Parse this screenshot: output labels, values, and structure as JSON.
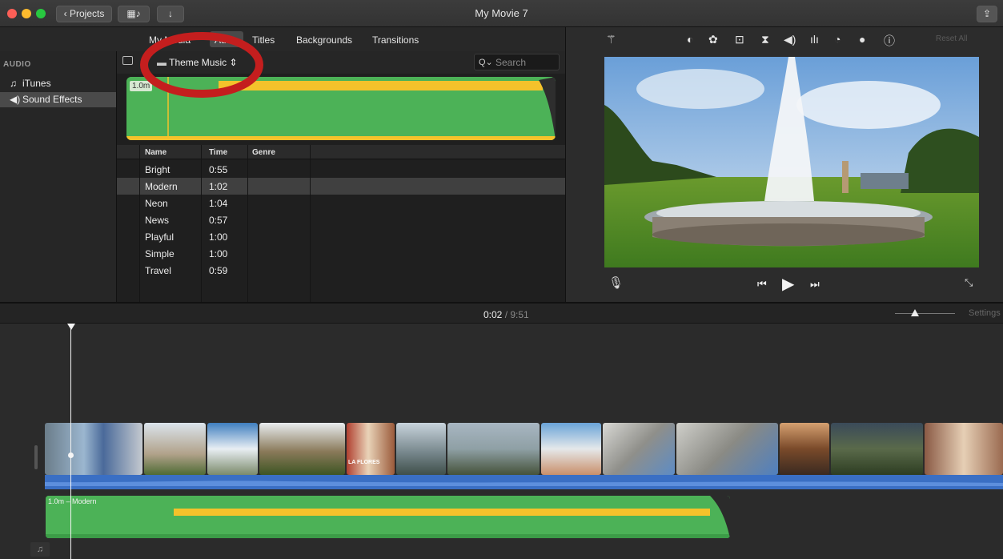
{
  "window": {
    "title": "My Movie 7"
  },
  "toolbar": {
    "projects_label": "Projects",
    "share_icon": "share-icon"
  },
  "browser": {
    "tabs": [
      "My Media",
      "Audio",
      "Titles",
      "Backgrounds",
      "Transitions"
    ],
    "sidebar": {
      "header": "AUDIO",
      "items": [
        {
          "label": "iTunes",
          "icon": "music-note-icon"
        },
        {
          "label": "Sound Effects",
          "icon": "speaker-icon"
        }
      ]
    },
    "source_menu": "Theme Music",
    "search_placeholder": "Search",
    "preview_badge": "1.0m",
    "columns": [
      "Name",
      "Time",
      "Genre"
    ],
    "rows": [
      {
        "name": "Bright",
        "time": "0:55",
        "genre": ""
      },
      {
        "name": "Modern",
        "time": "1:02",
        "genre": ""
      },
      {
        "name": "Neon",
        "time": "1:04",
        "genre": ""
      },
      {
        "name": "News",
        "time": "0:57",
        "genre": ""
      },
      {
        "name": "Playful",
        "time": "1:00",
        "genre": ""
      },
      {
        "name": "Simple",
        "time": "1:00",
        "genre": ""
      },
      {
        "name": "Travel",
        "time": "0:59",
        "genre": ""
      }
    ],
    "selected_row": 1
  },
  "viewer": {
    "reset_label": "Reset All",
    "adjust_icons": [
      "magic-wand-icon",
      "color-balance-icon",
      "color-palette-icon",
      "crop-icon",
      "stabilization-icon",
      "volume-icon",
      "equalizer-icon",
      "speed-icon",
      "noise-reduction-icon",
      "info-icon"
    ]
  },
  "timeline": {
    "current_time": "0:02",
    "total_time": "9:51",
    "settings_label": "Settings",
    "music_clip_label": "1.0m – Modern",
    "title_card_text": "LA FLORES"
  },
  "colors": {
    "annotation": "#c41e1e",
    "audio_green": "#4cb257",
    "audio_yellow": "#f4c22b",
    "video_audio_blue": "#3a6fc4"
  }
}
